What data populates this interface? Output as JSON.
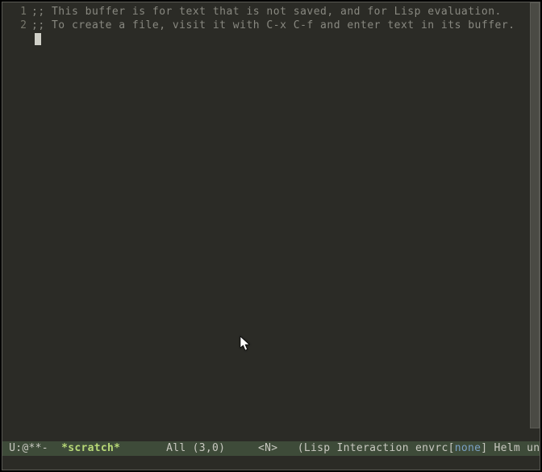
{
  "buffer": {
    "lines": [
      {
        "num": "1",
        "text": ";; This buffer is for text that is not saved, and for Lisp evaluation."
      },
      {
        "num": "2",
        "text": ";; To create a file, visit it with C-x C-f and enter text in its buffer."
      }
    ]
  },
  "modeline": {
    "status": " U:@**-  ",
    "buffer_name": "*scratch*",
    "spacer1": "       ",
    "position": "All (3,0)",
    "spacer2": "     ",
    "evil_state": "<N>",
    "spacer3": "   ",
    "mode_open": "(Lisp Interaction envrc[",
    "envrc_status": "none",
    "mode_close": "] Helm unim"
  }
}
